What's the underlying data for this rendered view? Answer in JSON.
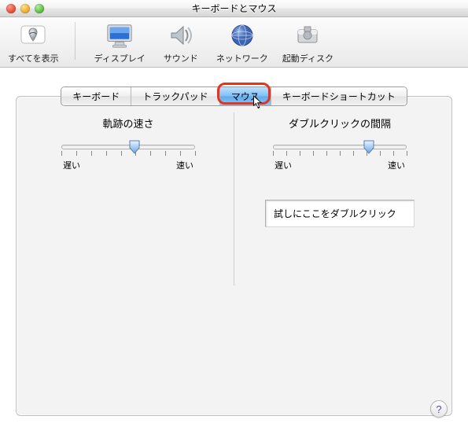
{
  "window": {
    "title": "キーボードとマウス"
  },
  "toolbar": {
    "showAll": "すべてを表示",
    "items": [
      {
        "label": "ディスプレイ",
        "icon": "display-icon"
      },
      {
        "label": "サウンド",
        "icon": "sound-icon"
      },
      {
        "label": "ネットワーク",
        "icon": "network-icon"
      },
      {
        "label": "起動ディスク",
        "icon": "startup-disk-icon"
      }
    ]
  },
  "tabs": {
    "items": [
      "キーボード",
      "トラックパッド",
      "マウス",
      "キーボードショートカット"
    ],
    "activeIndex": 2
  },
  "panels": {
    "tracking": {
      "title": "軌跡の速さ",
      "slowLabel": "遅い",
      "fastLabel": "速い",
      "valuePercent": 55
    },
    "doubleClick": {
      "title": "ダブルクリックの間隔",
      "slowLabel": "遅い",
      "fastLabel": "速い",
      "valuePercent": 72,
      "testText": "試しにここをダブルクリック"
    }
  },
  "help": {
    "label": "?"
  },
  "colors": {
    "highlight": "#e4331f",
    "aquaBlue": "#6fb2ee"
  }
}
